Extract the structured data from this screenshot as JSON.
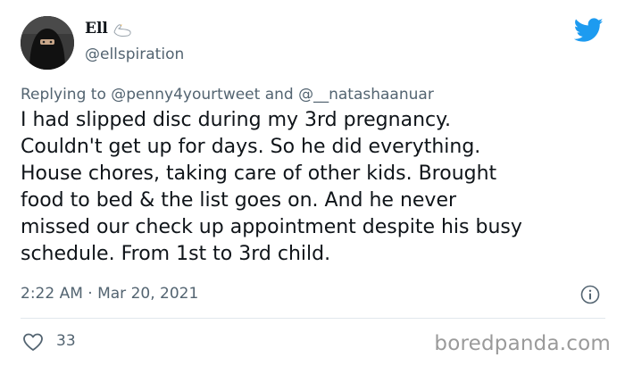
{
  "author": {
    "display_name": "Ell",
    "handle": "@ellspiration",
    "avatar_icon": "avatar-photo",
    "badge_icon": "swan-icon"
  },
  "reply": {
    "prefix": "Replying to",
    "mention_1": "@penny4yourtweet",
    "connector": "and",
    "mention_2": "@__natashaanuar"
  },
  "body": "I had slipped disc during my 3rd pregnancy.\nCouldn't get up for days. So he did everything.\nHouse chores, taking care of other kids. Brought\nfood to bed & the list goes on. And he never\nmissed our check up appointment despite his busy\nschedule. From 1st to 3rd child.",
  "meta": {
    "timestamp": "2:22 AM · Mar 20, 2021"
  },
  "actions": {
    "like_count": "33"
  },
  "watermark": "boredpanda.com",
  "colors": {
    "twitter_blue": "#1d9bf0",
    "secondary_text": "#536471",
    "primary_text": "#0f1419"
  }
}
